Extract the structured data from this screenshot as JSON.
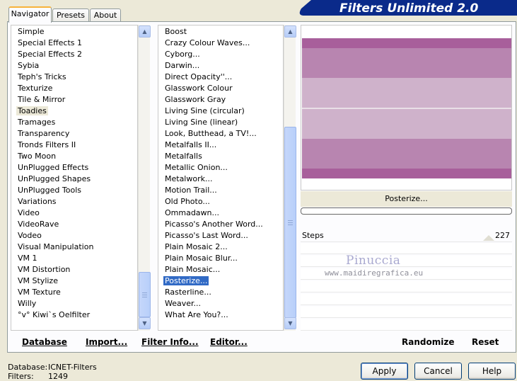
{
  "tabs": [
    "Navigator",
    "Presets",
    "About"
  ],
  "header_title": "Filters Unlimited 2.0",
  "categories": [
    "Simple",
    "Special Effects 1",
    "Special Effects 2",
    "Sybia",
    "Teph's Tricks",
    "Texturize",
    "Tile & Mirror",
    "Toadies",
    "Tramages",
    "Transparency",
    "Tronds Filters II",
    "Two Moon",
    "UnPlugged Effects",
    "UnPlugged Shapes",
    "UnPlugged Tools",
    "Variations",
    "Video",
    "VideoRave",
    "Vodeo",
    "Visual Manipulation",
    "VM 1",
    "VM Distortion",
    "VM Stylize",
    "VM Texture",
    "Willy",
    "°v° Kiwi`s Oelfilter"
  ],
  "selected_category": "Toadies",
  "filters": [
    "Boost",
    "Crazy Colour Waves...",
    "Cyborg...",
    "Darwin...",
    "Direct Opacity''...",
    "Glasswork Colour",
    "Glasswork Gray",
    "Living Sine (circular)",
    "Living Sine (linear)",
    "Look, Butthead, a TV!...",
    "Metalfalls II...",
    "Metalfalls",
    "Metallic Onion...",
    "Metalwork...",
    "Motion Trail...",
    "Old Photo...",
    "Ommadawn...",
    "Picasso's Another Word...",
    "Picasso's Last Word...",
    "Plain Mosaic 2...",
    "Plain Mosaic Blur...",
    "Plain Mosaic...",
    "Posterize...",
    "Rasterline...",
    "Weaver...",
    "What Are You?..."
  ],
  "selected_filter": "Posterize...",
  "preview": {
    "filter_name": "Posterize..."
  },
  "control": {
    "label": "Steps",
    "value": "227"
  },
  "watermark": {
    "line1": "Pinuccia",
    "line2": "www.maidiregrafica.eu"
  },
  "bottom_buttons": {
    "database": "Database",
    "import": "Import...",
    "filter_info": "Filter Info...",
    "editor": "Editor...",
    "randomize": "Randomize",
    "reset": "Reset"
  },
  "status": {
    "db_label": "Database:",
    "db_value": "ICNET-Filters",
    "filters_label": "Filters:",
    "filters_value": "1249"
  },
  "dialog_buttons": {
    "apply": "Apply",
    "cancel": "Cancel",
    "help": "Help"
  },
  "colors": {
    "selection_blue": "#316ac5",
    "header_navy": "#0a2a8a"
  }
}
